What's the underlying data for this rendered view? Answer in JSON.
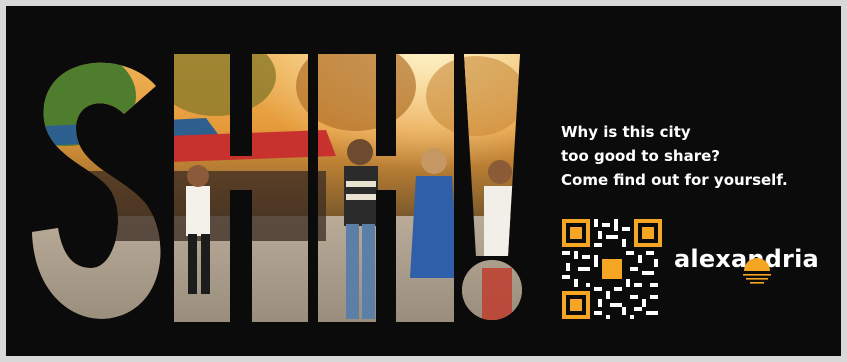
{
  "ad": {
    "headline": "SHH!",
    "tagline": [
      "Why is this city",
      "too good to share?",
      "Come find out for yourself."
    ],
    "brand": "alexandria",
    "colors": {
      "background": "#0b0b0b",
      "accent": "#f5a623",
      "text": "#ffffff"
    },
    "icons": [
      "qr-code-icon",
      "sun-mark-icon"
    ]
  }
}
